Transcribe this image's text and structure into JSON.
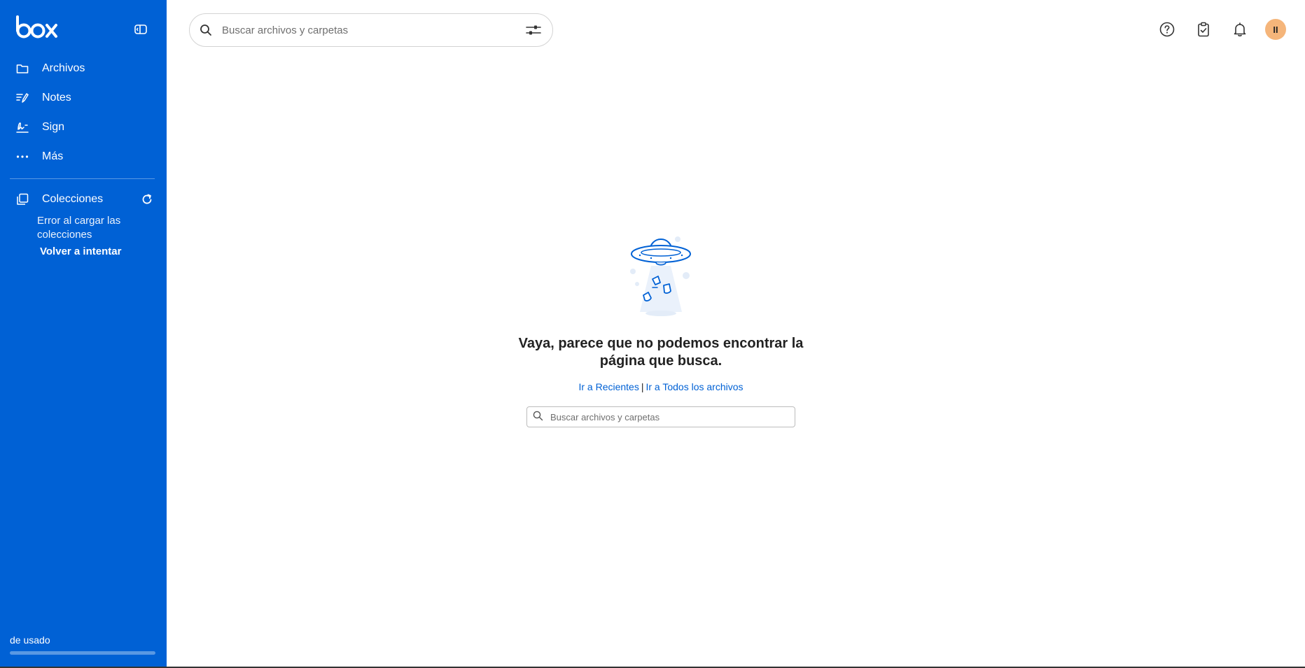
{
  "brand": {
    "logo_text": "box",
    "accent": "#0061d5"
  },
  "sidebar": {
    "items": [
      {
        "label": "Archivos",
        "icon": "folder-icon"
      },
      {
        "label": "Notes",
        "icon": "notes-icon"
      },
      {
        "label": "Sign",
        "icon": "sign-icon"
      },
      {
        "label": "Más",
        "icon": "more-icon"
      }
    ],
    "collections": {
      "label": "Colecciones",
      "error": "Error al cargar las colecciones",
      "retry": "Volver a intentar"
    },
    "usage": {
      "label": "de usado",
      "fraction": 0.0
    }
  },
  "header": {
    "search_placeholder": "Buscar archivos y carpetas",
    "avatar_initials": "II"
  },
  "main": {
    "error_title": "Vaya, parece que no podemos encontrar la página que busca.",
    "link_recents": "Ir a Recientes",
    "separator": "|",
    "link_all_files": "Ir a Todos los archivos",
    "search_placeholder": "Buscar archivos y carpetas"
  }
}
